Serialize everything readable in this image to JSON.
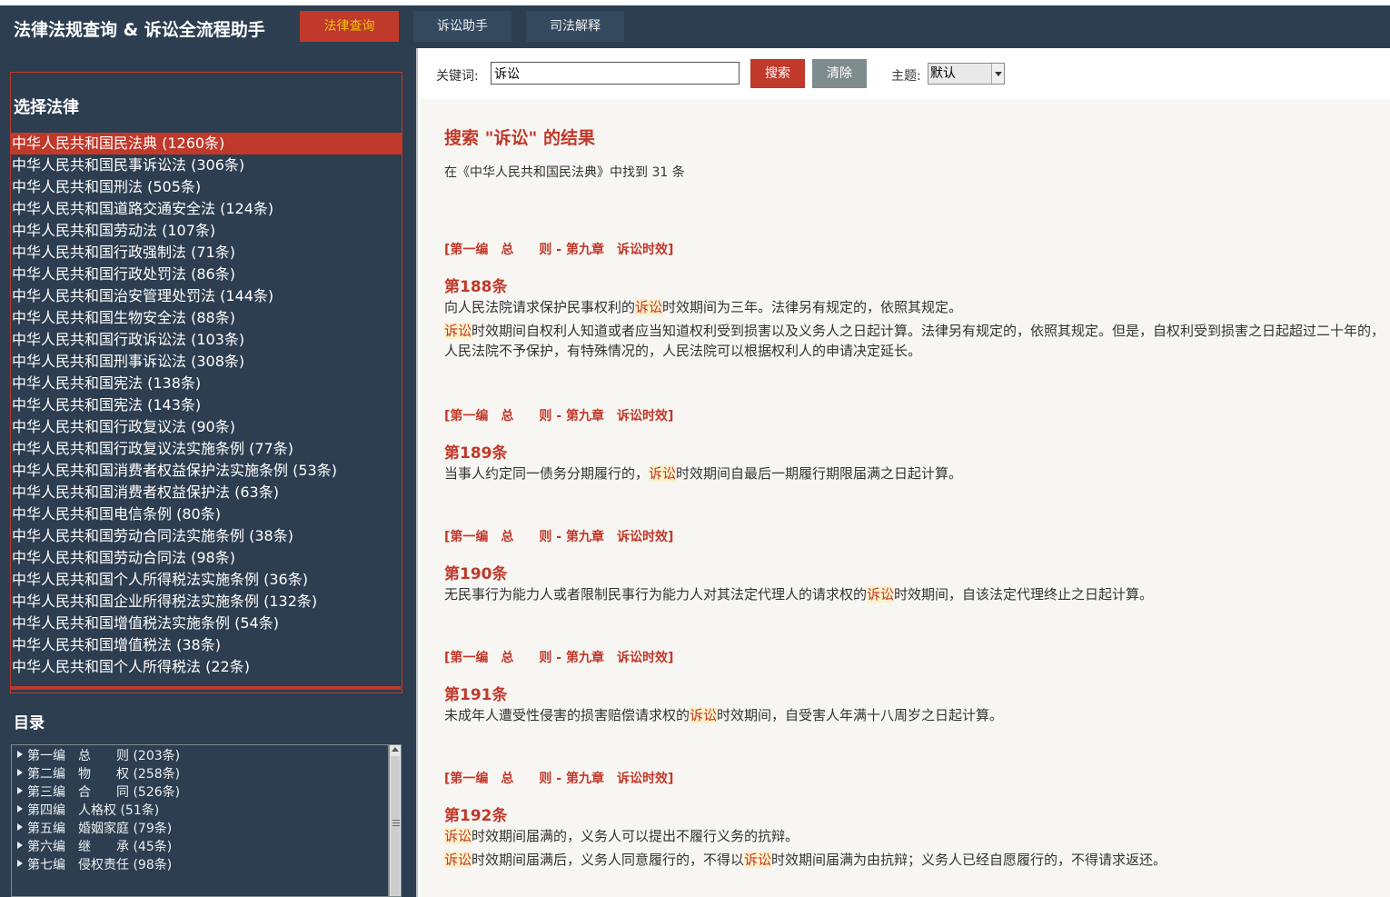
{
  "header": {
    "title": "法律法规查询 & 诉讼全流程助手",
    "tabs": [
      {
        "label": "法律查询",
        "active": true
      },
      {
        "label": "诉讼助手",
        "active": false
      },
      {
        "label": "司法解释",
        "active": false
      }
    ]
  },
  "sidebar": {
    "law_panel_title": "选择法律",
    "laws": [
      "中华人民共和国民法典 (1260条)",
      "中华人民共和国民事诉讼法 (306条)",
      "中华人民共和国刑法 (505条)",
      "中华人民共和国道路交通安全法 (124条)",
      "中华人民共和国劳动法 (107条)",
      "中华人民共和国行政强制法 (71条)",
      "中华人民共和国行政处罚法 (86条)",
      "中华人民共和国治安管理处罚法 (144条)",
      "中华人民共和国生物安全法 (88条)",
      "中华人民共和国行政诉讼法 (103条)",
      "中华人民共和国刑事诉讼法 (308条)",
      "中华人民共和国宪法 (138条)",
      "中华人民共和国宪法 (143条)",
      "中华人民共和国行政复议法 (90条)",
      "中华人民共和国行政复议法实施条例 (77条)",
      "中华人民共和国消费者权益保护法实施条例 (53条)",
      "中华人民共和国消费者权益保护法 (63条)",
      "中华人民共和国电信条例 (80条)",
      "中华人民共和国劳动合同法实施条例 (38条)",
      "中华人民共和国劳动合同法 (98条)",
      "中华人民共和国个人所得税法实施条例 (36条)",
      "中华人民共和国企业所得税法实施条例 (132条)",
      "中华人民共和国增值税法实施条例 (54条)",
      "中华人民共和国增值税法 (38条)",
      "中华人民共和国个人所得税法 (22条)"
    ],
    "selected_law_index": 0,
    "toc_title": "目录",
    "toc": [
      "第一编　总　　则 (203条)",
      "第二编　物　　权 (258条)",
      "第三编　合　　同 (526条)",
      "第四编　人格权 (51条)",
      "第五编　婚姻家庭 (79条)",
      "第六编　继　　承 (45条)",
      "第七编　侵权责任 (98条)"
    ]
  },
  "search": {
    "keyword_label": "关键词:",
    "keyword_value": "诉讼",
    "search_button": "搜索",
    "clear_button": "清除",
    "theme_label": "主题:",
    "theme_value": "默认"
  },
  "results": {
    "title": "搜索 \"诉讼\" 的结果",
    "summary": "在《中华人民共和国民法典》中找到 31 条",
    "articles": [
      {
        "path": "[第一编　总　　则 - 第九章　诉讼时效]",
        "number": "第188条",
        "paragraphs": [
          [
            "向人民法院请求保护民事权利的",
            "诉讼",
            "时效期间为三年。法律另有规定的，依照其规定。"
          ],
          [
            "",
            "诉讼",
            "时效期间自权利人知道或者应当知道权利受到损害以及义务人之日起计算。法律另有规定的，依照其规定。但是，自权利受到损害之日起超过二十年的，人民法院不予保护，有特殊情况的，人民法院可以根据权利人的申请决定延长。"
          ]
        ]
      },
      {
        "path": "[第一编　总　　则 - 第九章　诉讼时效]",
        "number": "第189条",
        "paragraphs": [
          [
            "当事人约定同一债务分期履行的，",
            "诉讼",
            "时效期间自最后一期履行期限届满之日起计算。"
          ]
        ]
      },
      {
        "path": "[第一编　总　　则 - 第九章　诉讼时效]",
        "number": "第190条",
        "paragraphs": [
          [
            "无民事行为能力人或者限制民事行为能力人对其法定代理人的请求权的",
            "诉讼",
            "时效期间，自该法定代理终止之日起计算。"
          ]
        ]
      },
      {
        "path": "[第一编　总　　则 - 第九章　诉讼时效]",
        "number": "第191条",
        "paragraphs": [
          [
            "未成年人遭受性侵害的损害赔偿请求权的",
            "诉讼",
            "时效期间，自受害人年满十八周岁之日起计算。"
          ]
        ]
      },
      {
        "path": "[第一编　总　　则 - 第九章　诉讼时效]",
        "number": "第192条",
        "paragraphs": [
          [
            "",
            "诉讼",
            "时效期间届满的，义务人可以提出不履行义务的抗辩。"
          ],
          [
            "",
            "诉讼",
            "时效期间届满后，义务人同意履行的，不得以",
            "诉讼",
            "时效期间届满为由抗辩；义务人已经自愿履行的，不得请求返还。"
          ]
        ]
      }
    ]
  },
  "colors": {
    "header_bg": "#2c3e50",
    "accent_red": "#c0392b",
    "active_tab_text": "#f1c40f",
    "highlight_bg": "#fdf1c7",
    "main_bg": "#f8f6f2"
  }
}
